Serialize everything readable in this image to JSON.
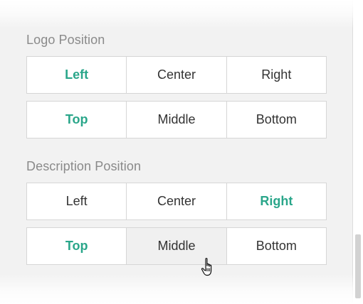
{
  "sections": [
    {
      "label": "Logo Position",
      "horizontal": [
        {
          "label": "Left",
          "selected": true
        },
        {
          "label": "Center",
          "selected": false
        },
        {
          "label": "Right",
          "selected": false
        }
      ],
      "vertical": [
        {
          "label": "Top",
          "selected": true
        },
        {
          "label": "Middle",
          "selected": false
        },
        {
          "label": "Bottom",
          "selected": false
        }
      ]
    },
    {
      "label": "Description Position",
      "horizontal": [
        {
          "label": "Left",
          "selected": false
        },
        {
          "label": "Center",
          "selected": false
        },
        {
          "label": "Right",
          "selected": true
        }
      ],
      "vertical": [
        {
          "label": "Top",
          "selected": true
        },
        {
          "label": "Middle",
          "selected": false,
          "hovered": true
        },
        {
          "label": "Bottom",
          "selected": false
        }
      ]
    }
  ],
  "colors": {
    "accent": "#2aa68a",
    "panel_background": "#f2f2f2",
    "border": "#d6d6d6",
    "text": "#333333",
    "label_text": "#8a8a8a"
  },
  "icons": {
    "cursor": "hand-pointer-icon"
  }
}
